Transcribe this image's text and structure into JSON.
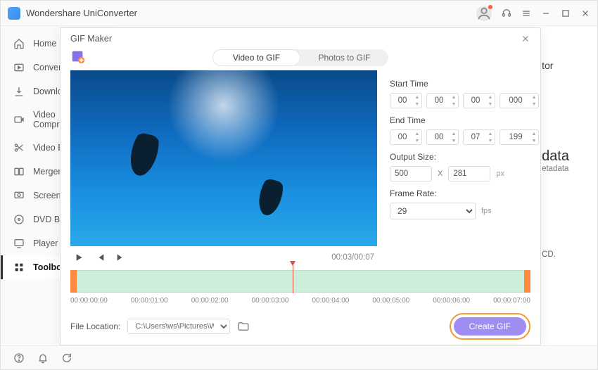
{
  "app_title": "Wondershare UniConverter",
  "sidebar": {
    "items": [
      {
        "label": "Home"
      },
      {
        "label": "Converter"
      },
      {
        "label": "Downloader"
      },
      {
        "label": "Video Compressor"
      },
      {
        "label": "Video Editor"
      },
      {
        "label": "Merger"
      },
      {
        "label": "Screen Recorder"
      },
      {
        "label": "DVD Burner"
      },
      {
        "label": "Player"
      },
      {
        "label": "Toolbox"
      }
    ]
  },
  "gif_modal": {
    "title": "GIF Maker",
    "tabs": {
      "video": "Video to GIF",
      "photos": "Photos to GIF"
    },
    "start_label": "Start Time",
    "end_label": "End Time",
    "start": {
      "h": "00",
      "m": "00",
      "s": "00",
      "ms": "000"
    },
    "end": {
      "h": "00",
      "m": "00",
      "s": "07",
      "ms": "199"
    },
    "output_label": "Output Size:",
    "output_w": "500",
    "output_x": "X",
    "output_h": "281",
    "output_unit": "px",
    "frame_label": "Frame Rate:",
    "frame_value": "29",
    "frame_unit": "fps",
    "time_current": "00:03",
    "time_total": "00:07",
    "timeline_ticks": [
      "00:00:00:00",
      "00:00:01:00",
      "00:00:02:00",
      "00:00:03:00",
      "00:00:04:00",
      "00:00:05:00",
      "00:00:06:00",
      "00:00:07:00"
    ],
    "file_label": "File Location:",
    "file_path": "C:\\Users\\ws\\Pictures\\Wonders",
    "create_label": "Create GIF"
  },
  "bg": {
    "suffix_tor": "tor",
    "data": "data",
    "etadata": "etadata",
    "cd": "CD."
  }
}
